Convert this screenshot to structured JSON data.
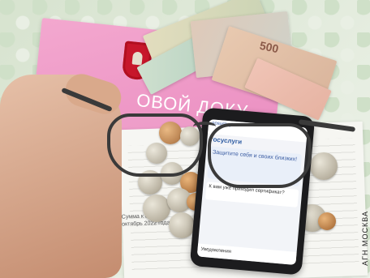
{
  "folder": {
    "text": "ОВОЙ ДОКУ"
  },
  "banknote": {
    "denomination": "500"
  },
  "paper": {
    "text_lines": [
      "Сумма к оплате",
      "октябрь 2022 года"
    ]
  },
  "phone": {
    "status": "gosuslugi",
    "logo": "госуслуги",
    "banner": "Защитите себя и своих близких!",
    "card": "К вам уже приходил сертификат?",
    "bottom": "Уведомления"
  },
  "caption": {
    "text": "АГН МОСКВА"
  }
}
